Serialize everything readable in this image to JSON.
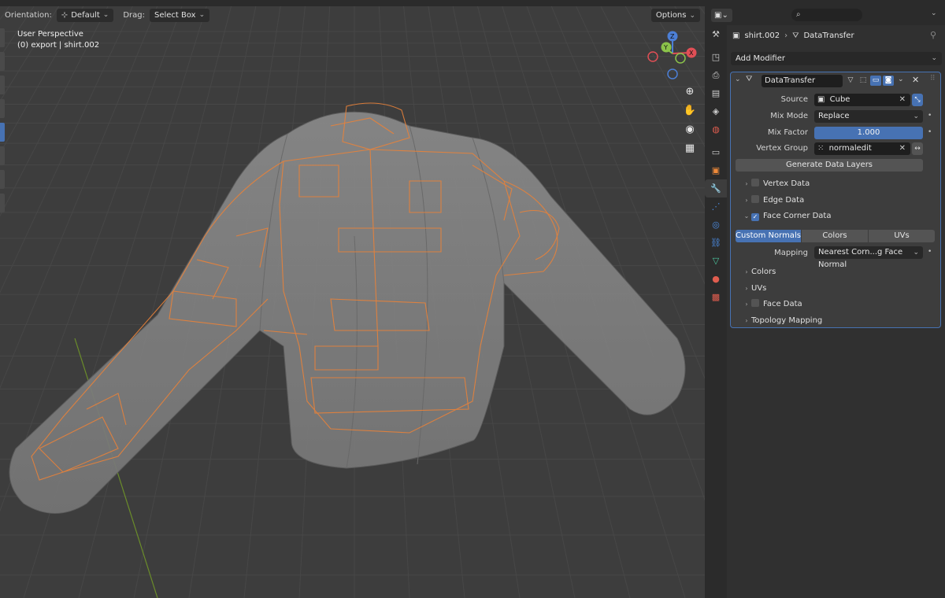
{
  "viewport": {
    "toolbar": {
      "orientation_label": "Orientation:",
      "orientation_value": "Default",
      "drag_label": "Drag:",
      "drag_value": "Select Box",
      "options_label": "Options"
    },
    "overlay": {
      "view_name": "User Perspective",
      "collection_object": "(0) export | shirt.002"
    },
    "gizmo": {
      "x_label": "X",
      "y_label": "Y",
      "z_label": "Z"
    },
    "nav_icons": [
      "zoom-icon",
      "hand-pan-icon",
      "camera-icon",
      "grid-ortho-icon"
    ]
  },
  "properties": {
    "search_placeholder": "",
    "breadcrumb": {
      "object": "shirt.002",
      "separator": "›",
      "modifier": "DataTransfer"
    },
    "add_modifier_label": "Add Modifier",
    "modifier": {
      "name": "DataTransfer",
      "source_label": "Source",
      "source_value": "Cube",
      "mix_mode_label": "Mix Mode",
      "mix_mode_value": "Replace",
      "mix_factor_label": "Mix Factor",
      "mix_factor_value": "1.000",
      "vertex_group_label": "Vertex Group",
      "vertex_group_value": "normaledit",
      "generate_button": "Generate Data Layers",
      "subpanels": {
        "vertex_data": "Vertex Data",
        "edge_data": "Edge Data",
        "face_corner_data": "Face Corner Data",
        "colors": "Colors",
        "uvs": "UVs",
        "face_data": "Face Data",
        "topology_mapping": "Topology Mapping"
      },
      "face_corner_checked": true,
      "tabs": [
        "Custom Normals",
        "Colors",
        "UVs"
      ],
      "active_tab": "Custom Normals",
      "mapping_label": "Mapping",
      "mapping_value": "Nearest Corn...g Face Normal"
    }
  },
  "colors": {
    "accent": "#4772b3",
    "selection_orange": "#e8823a",
    "viewport_bg": "#3d3d3d"
  }
}
